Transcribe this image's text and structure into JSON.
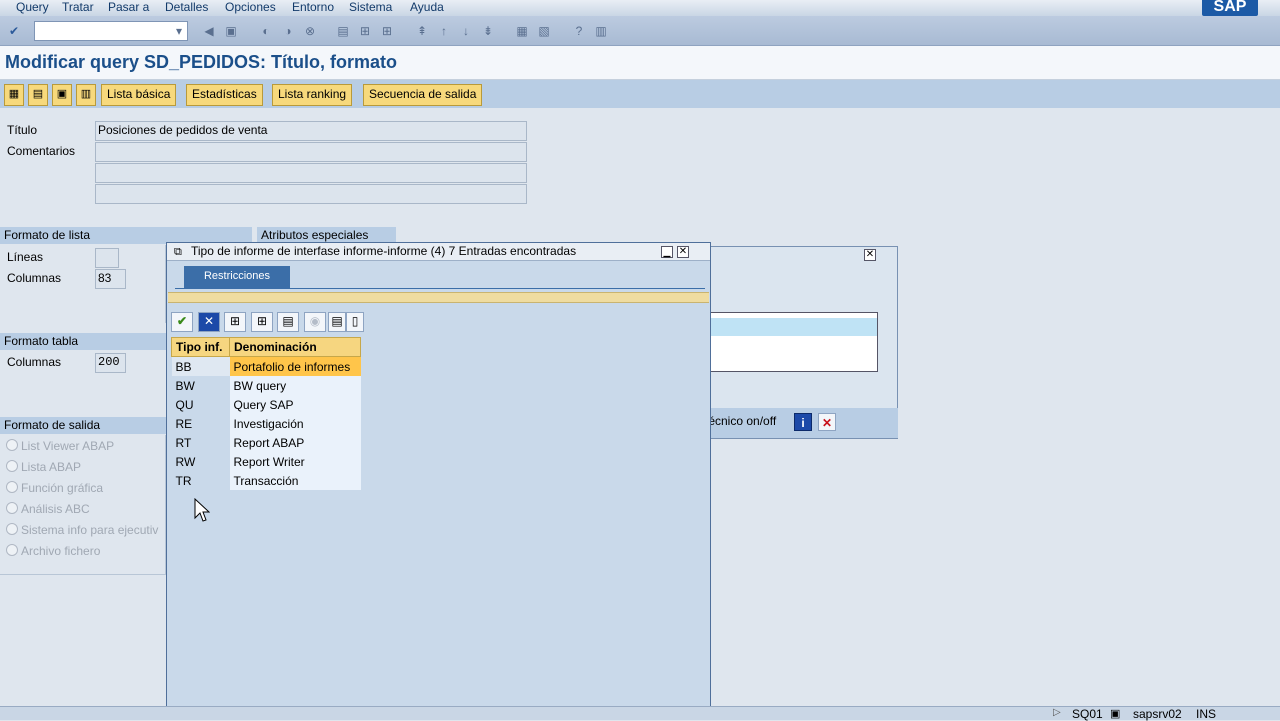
{
  "menu": [
    "Query",
    "Tratar",
    "Pasar a",
    "Detalles",
    "Opciones",
    "Entorno",
    "Sistema",
    "Ayuda"
  ],
  "logo": "SAP",
  "page_title": "Modificar query SD_PEDIDOS: Título, formato",
  "app_toolbar": {
    "buttons": [
      "Lista básica",
      "Estadísticas",
      "Lista ranking",
      "Secuencia de salida"
    ]
  },
  "form": {
    "titulo_label": "Título",
    "titulo_value": "Posiciones de pedidos de venta",
    "comentarios_label": "Comentarios"
  },
  "formato_lista": {
    "header": "Formato de lista",
    "lineas_label": "Líneas",
    "columnas_label": "Columnas",
    "columnas_value": "83"
  },
  "atributos": {
    "header": "Atributos especiales"
  },
  "formato_tabla": {
    "header": "Formato tabla",
    "columnas_label": "Columnas",
    "columnas_value": "200"
  },
  "formato_salida": {
    "header": "Formato de salida",
    "options": [
      "List Viewer ABAP",
      "Lista ABAP",
      "Función gráfica",
      "Análisis ABC",
      "Sistema info para ejecutiv",
      "Archivo fichero"
    ]
  },
  "bg_dialog": {
    "button_label": "técnico on/off"
  },
  "popup": {
    "title": "Tipo de informe de interfase informe-informe (4)    7 Entradas encontradas",
    "tab": "Restricciones",
    "columns": [
      "Tipo inf.",
      "Denominación"
    ],
    "rows": [
      {
        "code": "BB",
        "name": "Portafolio de informes"
      },
      {
        "code": "BW",
        "name": "BW query"
      },
      {
        "code": "QU",
        "name": "Query SAP"
      },
      {
        "code": "RE",
        "name": "Investigación"
      },
      {
        "code": "RT",
        "name": "Report ABAP"
      },
      {
        "code": "RW",
        "name": "Report Writer"
      },
      {
        "code": "TR",
        "name": "Transacción"
      }
    ]
  },
  "status": {
    "tcode": "SQ01",
    "server": "sapsrv02",
    "mode": "INS"
  }
}
